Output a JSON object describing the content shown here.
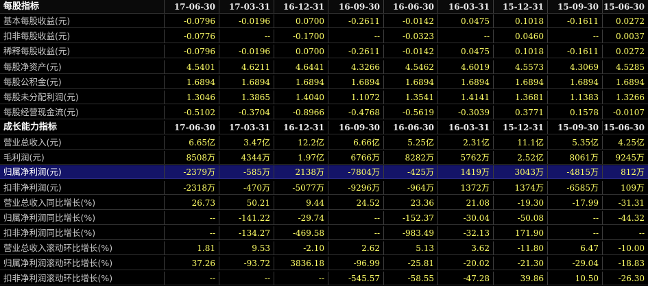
{
  "sections": [
    {
      "title": "每股指标",
      "dates": [
        "17-06-30",
        "17-03-31",
        "16-12-31",
        "16-09-30",
        "16-06-30",
        "16-03-31",
        "15-12-31",
        "15-09-30",
        "15-06-30"
      ],
      "rows": [
        {
          "label": "基本每股收益(元)",
          "values": [
            "-0.0796",
            "-0.0196",
            "0.0700",
            "-0.2611",
            "-0.0142",
            "0.0475",
            "0.1018",
            "-0.1611",
            "0.0272"
          ]
        },
        {
          "label": "扣非每股收益(元)",
          "values": [
            "-0.0776",
            "--",
            "-0.1700",
            "--",
            "-0.0323",
            "--",
            "0.0460",
            "--",
            "0.0037"
          ]
        },
        {
          "label": "稀释每股收益(元)",
          "values": [
            "-0.0796",
            "-0.0196",
            "0.0700",
            "-0.2611",
            "-0.0142",
            "0.0475",
            "0.1018",
            "-0.1611",
            "0.0272"
          ]
        },
        {
          "label": "每股净资产(元)",
          "values": [
            "4.5401",
            "4.6211",
            "4.6441",
            "4.3266",
            "4.5462",
            "4.6019",
            "4.5573",
            "4.3069",
            "4.5285"
          ]
        },
        {
          "label": "每股公积金(元)",
          "values": [
            "1.6894",
            "1.6894",
            "1.6894",
            "1.6894",
            "1.6894",
            "1.6894",
            "1.6894",
            "1.6894",
            "1.6894"
          ]
        },
        {
          "label": "每股未分配利润(元)",
          "values": [
            "1.3046",
            "1.3865",
            "1.4040",
            "1.1072",
            "1.3541",
            "1.4141",
            "1.3681",
            "1.1383",
            "1.3266"
          ]
        },
        {
          "label": "每股经营现金流(元)",
          "values": [
            "-0.5102",
            "-0.3704",
            "-0.8966",
            "-0.4768",
            "-0.5619",
            "-0.3039",
            "0.3771",
            "0.1578",
            "-0.0107"
          ]
        }
      ]
    },
    {
      "title": "成长能力指标",
      "dates": [
        "17-06-30",
        "17-03-31",
        "16-12-31",
        "16-09-30",
        "16-06-30",
        "16-03-31",
        "15-12-31",
        "15-09-30",
        "15-06-30"
      ],
      "rows": [
        {
          "label": "营业总收入(元)",
          "values": [
            "6.65亿",
            "3.47亿",
            "12.2亿",
            "6.66亿",
            "5.25亿",
            "2.31亿",
            "11.1亿",
            "5.35亿",
            "4.25亿"
          ]
        },
        {
          "label": "毛利润(元)",
          "values": [
            "8508万",
            "4344万",
            "1.97亿",
            "6766万",
            "8282万",
            "5762万",
            "2.52亿",
            "8061万",
            "9245万"
          ]
        },
        {
          "label": "归属净利润(元)",
          "highlight": true,
          "values": [
            "-2379万",
            "-585万",
            "2138万",
            "-7804万",
            "-425万",
            "1419万",
            "3043万",
            "-4815万",
            "812万"
          ]
        },
        {
          "label": "扣非净利润(元)",
          "values": [
            "-2318万",
            "-470万",
            "-5077万",
            "-9296万",
            "-964万",
            "1372万",
            "1374万",
            "-6585万",
            "109万"
          ]
        },
        {
          "label": "营业总收入同比增长(%)",
          "values": [
            "26.73",
            "50.21",
            "9.44",
            "24.52",
            "23.36",
            "21.08",
            "-19.30",
            "-17.99",
            "-31.31"
          ]
        },
        {
          "label": "归属净利润同比增长(%)",
          "values": [
            "--",
            "-141.22",
            "-29.74",
            "--",
            "-152.37",
            "-30.04",
            "-50.08",
            "--",
            "-44.32"
          ]
        },
        {
          "label": "扣非净利润同比增长(%)",
          "values": [
            "--",
            "-134.27",
            "-469.58",
            "--",
            "-983.49",
            "-32.13",
            "171.90",
            "--",
            "--"
          ]
        },
        {
          "label": "营业总收入滚动环比增长(%)",
          "values": [
            "1.81",
            "9.53",
            "-2.10",
            "2.62",
            "5.13",
            "3.62",
            "-11.80",
            "6.47",
            "-10.00"
          ]
        },
        {
          "label": "归属净利润滚动环比增长(%)",
          "values": [
            "37.26",
            "-93.72",
            "3836.18",
            "-96.99",
            "-25.81",
            "-20.02",
            "-21.30",
            "-29.04",
            "-18.83"
          ]
        },
        {
          "label": "扣非净利润滚动环比增长(%)",
          "values": [
            "--",
            "--",
            "--",
            "-545.57",
            "-58.55",
            "-47.28",
            "39.86",
            "10.50",
            "-26.30"
          ]
        }
      ]
    }
  ],
  "colors": {
    "background": "#000000",
    "value_text": "#ffff66",
    "label_text": "#c8c8c8",
    "header_text": "#ffffff",
    "highlight_row": "#141468",
    "grid_line": "#3c3c3c"
  }
}
